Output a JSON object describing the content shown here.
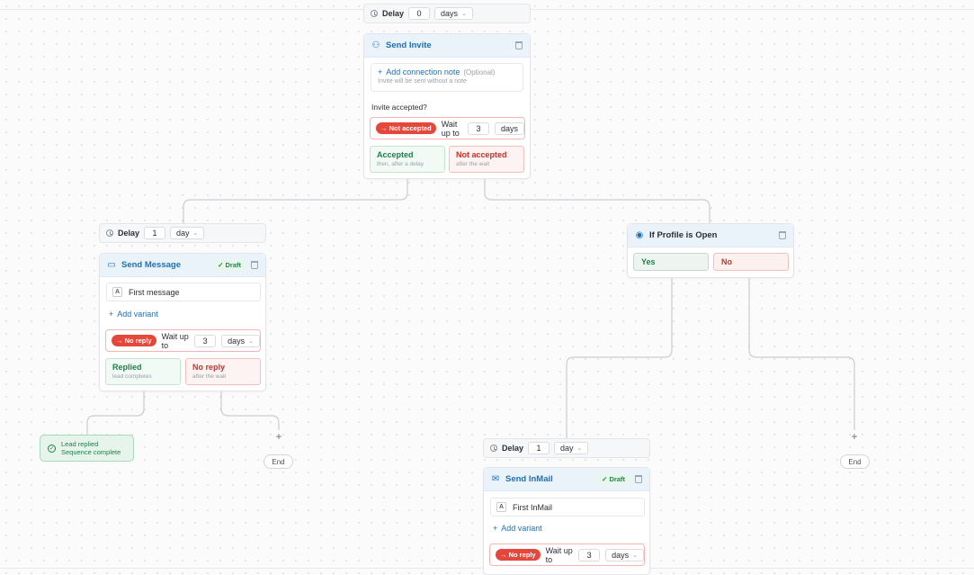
{
  "delay_top": {
    "label": "Delay",
    "value": "0",
    "unit": "days"
  },
  "send_invite": {
    "title": "Send Invite",
    "add_note_label": "Add connection note",
    "optional_label": "(Optional)",
    "note_sub": "Invite will be sent without a note",
    "question": "Invite accepted?",
    "wait_pill": "Not accepted",
    "wait_label": "Wait up to",
    "wait_value": "3",
    "wait_unit": "days",
    "accepted_title": "Accepted",
    "accepted_sub": "then, after a delay",
    "not_accepted_title": "Not accepted",
    "not_accepted_sub": "after the wait"
  },
  "delay_left": {
    "label": "Delay",
    "value": "1",
    "unit": "day"
  },
  "send_message": {
    "title": "Send Message",
    "draft": "Draft",
    "variant_badge": "A",
    "message_label": "First message",
    "add_variant": "Add variant",
    "wait_pill": "No reply",
    "wait_label": "Wait up to",
    "wait_value": "3",
    "wait_unit": "days",
    "replied_title": "Replied",
    "replied_sub": "lead completes",
    "noreply_title": "No reply",
    "noreply_sub": "after the wait"
  },
  "lead_replied": {
    "line1": "Lead replied",
    "line2": "Sequence complete"
  },
  "end_left": {
    "plus": "+",
    "label": "End"
  },
  "profile_open": {
    "title": "If Profile is Open",
    "yes": "Yes",
    "no": "No"
  },
  "delay_mid": {
    "label": "Delay",
    "value": "1",
    "unit": "day"
  },
  "send_inmail": {
    "title": "Send InMail",
    "draft": "Draft",
    "variant_badge": "A",
    "message_label": "First InMail",
    "add_variant": "Add variant",
    "wait_pill": "No reply",
    "wait_label": "Wait up to",
    "wait_value": "3",
    "wait_unit": "days"
  },
  "end_right": {
    "plus": "+",
    "label": "End"
  },
  "colors": {
    "accent": "#1e6fb8",
    "danger": "#e5483b",
    "success": "#1e7f47"
  }
}
